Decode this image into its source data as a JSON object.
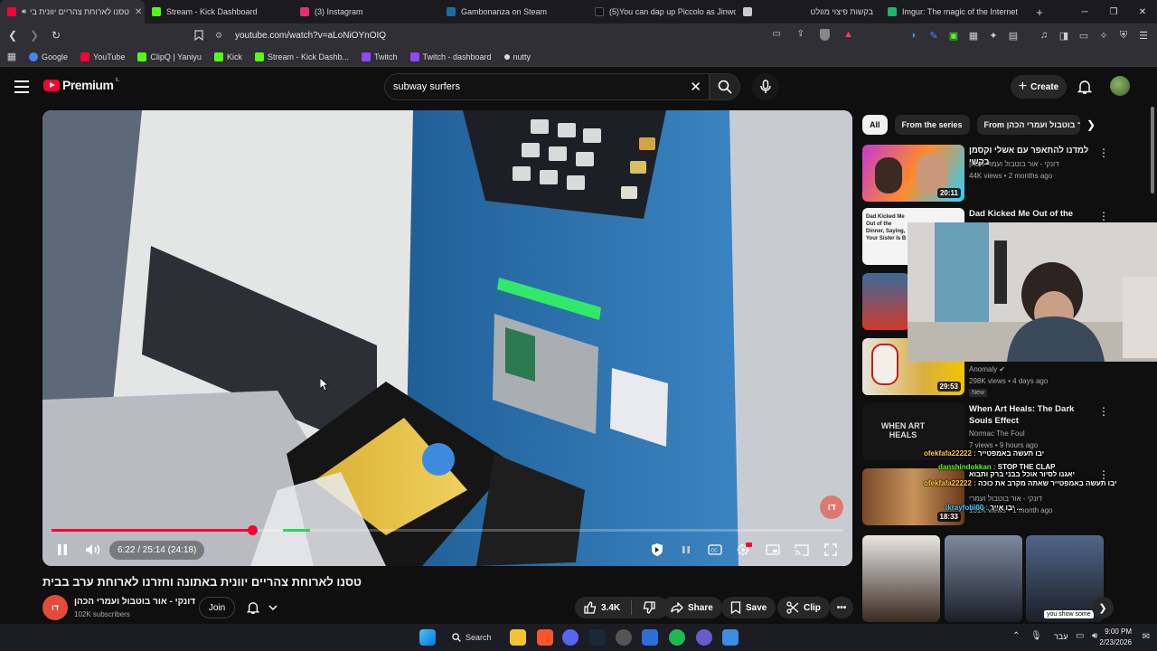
{
  "browser": {
    "tabs": [
      {
        "label": "טסנו לארוחת צהריים יוונית בי",
        "favicon_color": "#ff0033",
        "active": true,
        "muted_icon": "speaker-icon"
      },
      {
        "label": "Stream - Kick Dashboard",
        "favicon_color": "#53fc18"
      },
      {
        "label": "(3) Instagram",
        "favicon_color": "#e1306c"
      },
      {
        "label": "Gambonanza on Steam",
        "favicon_color": "#1b6ea5"
      },
      {
        "label": "(5)You can dap up Piccolo as Jinwoo",
        "favicon_color": "#111111"
      },
      {
        "label": "בקשות פיצוי מוולט",
        "favicon_color": "#cccccc"
      },
      {
        "label": "Imgur: The magic of the Internet",
        "favicon_color": "#1bb76e"
      }
    ],
    "new_tab": "+",
    "url": "youtube.com/watch?v=aLoNiOYnOIQ",
    "bookmarks": [
      {
        "label": "Google",
        "color": "#4285f4"
      },
      {
        "label": "YouTube",
        "color": "#ff0033"
      },
      {
        "label": "ClipQ | Yaniyu",
        "color": "#53fc18"
      },
      {
        "label": "Kick",
        "color": "#53fc18"
      },
      {
        "label": "Stream - Kick Dashb...",
        "color": "#53fc18"
      },
      {
        "label": "Twitch",
        "color": "#9146ff"
      },
      {
        "label": "Twitch - dashboard",
        "color": "#9146ff"
      },
      {
        "label": "nutty",
        "color": "#dddddd"
      }
    ]
  },
  "youtube": {
    "logo_text": "Premium",
    "logo_country": "IL",
    "search_value": "subway surfers",
    "create_label": "Create"
  },
  "player": {
    "time_display": "6:22 / 25:14 (24:18)",
    "progress_fraction": 0.253,
    "buffer_fraction": 0.262,
    "sponsor_segment": [
      0.292,
      0.327
    ],
    "watermark": "דו"
  },
  "video": {
    "title": "טסנו לארוחת צהריים יוונית באתונה וחזרנו לארוחת ערב בבית",
    "channel": "דונקי - אור בוטבול ועמרי הכהן",
    "subscribers": "102K subscribers",
    "join_label": "Join",
    "likes": "3.4K",
    "share_label": "Share",
    "save_label": "Save",
    "clip_label": "Clip"
  },
  "sidebar": {
    "chips": [
      "All",
      "From the series",
      "From אור בוטבול ועמרי הכהן"
    ],
    "recommendations": [
      {
        "title": "למדנו להתאפר עם אשלי וקסמן בקשי",
        "channel": "דונקי - אור בוטבול ועמרי הכהן",
        "meta": "44K views • 2 months ago",
        "duration": "20:11"
      },
      {
        "title": "Dad Kicked Me Out of the",
        "channel": "",
        "meta": "",
        "duration": "",
        "thumb_text": "Dad Kicked Me Out of the Dinner, Saying, Your Sister Is B"
      },
      {
        "title": "",
        "channel": "",
        "meta": "",
        "duration": ""
      },
      {
        "title": "",
        "channel": "Anomaly",
        "meta": "298K views • 4 days ago",
        "duration": "29:53",
        "badge": "New"
      },
      {
        "title": "When Art Heals: The Dark Souls Effect",
        "channel": "Normac The Foul",
        "meta": "7 views • 9 hours ago",
        "duration": "",
        "thumb_text": "WHEN ART HEALS"
      },
      {
        "title": "",
        "channel": "דונקי - אור בוטבול ועמרי הכהן",
        "meta": "131K views • 1 month ago",
        "duration": "18:33"
      }
    ],
    "shorts_captions": [
      "",
      "",
      "you show some"
    ]
  },
  "chat_overlay": [
    {
      "user": "ofekfafa22222",
      "text": "יבו תעשה באמפטייר",
      "color": "#ffcc33"
    },
    {
      "user": "danshindokkan",
      "text": "STOP THE CLAP",
      "color": "#53fc18"
    },
    {
      "user": "",
      "text": "יאגנו לסיור אוכל בבני ברק ותבוא",
      "color": "#ffffff"
    },
    {
      "user": "ofekfafa22222",
      "text": "יבו תעשה באמפטייר שאתה מקרב את כוכה",
      "color": "#ffcc33"
    },
    {
      "user": "ikrayfobi00",
      "text": "יבו אייר ...",
      "color": "#33ccff"
    }
  ],
  "taskbar": {
    "search_label": "Search",
    "lang": "עבר",
    "time": "9:00 PM",
    "date": "2/23/2026"
  }
}
